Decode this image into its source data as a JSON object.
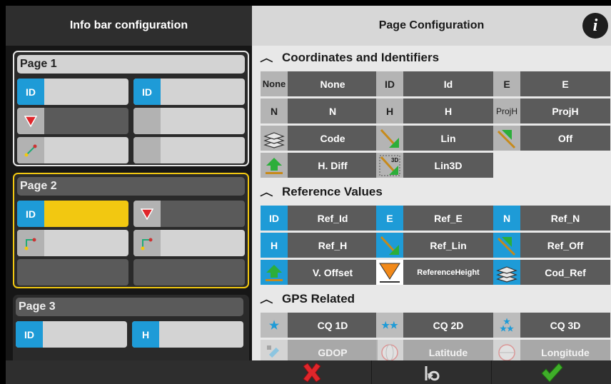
{
  "left": {
    "title": "Info bar configuration",
    "pages": [
      {
        "title": "Page 1",
        "slots": [
          {
            "tag": "ID",
            "kind": "blue",
            "style": "light"
          },
          {
            "tag": "ID",
            "kind": "blue",
            "style": "light"
          },
          {
            "tag": "",
            "kind": "triangle",
            "style": "dark"
          },
          {
            "tag": "",
            "kind": "gray",
            "style": "light"
          },
          {
            "tag": "",
            "kind": "line",
            "style": "light"
          },
          {
            "tag": "",
            "kind": "gray",
            "style": "light"
          }
        ]
      },
      {
        "title": "Page 2",
        "slots": [
          {
            "tag": "ID",
            "kind": "blue",
            "style": "yellow"
          },
          {
            "tag": "",
            "kind": "triangle",
            "style": "dark"
          },
          {
            "tag": "",
            "kind": "pin",
            "style": "light"
          },
          {
            "tag": "",
            "kind": "pin",
            "style": "light"
          },
          {
            "tag": "",
            "kind": "none",
            "style": "dark"
          },
          {
            "tag": "",
            "kind": "none",
            "style": "dark"
          }
        ]
      },
      {
        "title": "Page 3",
        "slots": [
          {
            "tag": "ID",
            "kind": "blue",
            "style": "light"
          },
          {
            "tag": "H",
            "kind": "blue",
            "style": "light"
          }
        ]
      }
    ]
  },
  "right": {
    "title": "Page Configuration",
    "info_label": "i",
    "sections": [
      {
        "title": "Coordinates and Identifiers",
        "rows": [
          [
            {
              "icon": "None",
              "label": "None"
            },
            {
              "icon": "ID",
              "label": "Id"
            },
            {
              "icon": "E",
              "label": "E"
            }
          ],
          [
            {
              "icon": "N",
              "label": "N"
            },
            {
              "icon": "H",
              "label": "H"
            },
            {
              "icon": "ProjH",
              "label": "ProjH"
            }
          ],
          [
            {
              "icon": "layers-icon",
              "label": "Code"
            },
            {
              "icon": "line-arrow-icon",
              "label": "Lin"
            },
            {
              "icon": "offset-arrow-icon",
              "label": "Off"
            }
          ],
          [
            {
              "icon": "height-diff-icon",
              "label": "H. Diff"
            },
            {
              "icon": "line-3d-icon",
              "label": "Lin3D"
            }
          ]
        ]
      },
      {
        "title": "Reference Values",
        "rows": [
          [
            {
              "icon": "ID",
              "label": "Ref_Id"
            },
            {
              "icon": "E",
              "label": "Ref_E"
            },
            {
              "icon": "N",
              "label": "Ref_N"
            }
          ],
          [
            {
              "icon": "H",
              "label": "Ref_H"
            },
            {
              "icon": "line-arrow-icon",
              "label": "Ref_Lin"
            },
            {
              "icon": "offset-arrow-icon",
              "label": "Ref_Off"
            }
          ],
          [
            {
              "icon": "vertical-offset-icon",
              "label": "V. Offset"
            },
            {
              "icon": "triangle-height-icon",
              "label": "ReferenceHeight"
            },
            {
              "icon": "layers-icon",
              "label": "Cod_Ref"
            }
          ]
        ]
      },
      {
        "title": "GPS Related",
        "rows": [
          [
            {
              "icon": "one-star-icon",
              "label": "CQ 1D"
            },
            {
              "icon": "two-star-icon",
              "label": "CQ 2D"
            },
            {
              "icon": "three-star-icon",
              "label": "CQ 3D"
            }
          ],
          [
            {
              "icon": "satellite-icon",
              "label": "GDOP"
            },
            {
              "icon": "globe-icon",
              "label": "Latitude"
            },
            {
              "icon": "globe-icon",
              "label": "Longitude"
            }
          ]
        ]
      }
    ]
  },
  "footer": {
    "buttons": [
      "cancel-icon",
      "undo-icon",
      "confirm-icon"
    ]
  },
  "colors": {
    "accent_blue": "#1e9bd7",
    "selected_yellow": "#f2c811",
    "cancel_red": "#e0262b",
    "confirm_green": "#3fae29"
  }
}
